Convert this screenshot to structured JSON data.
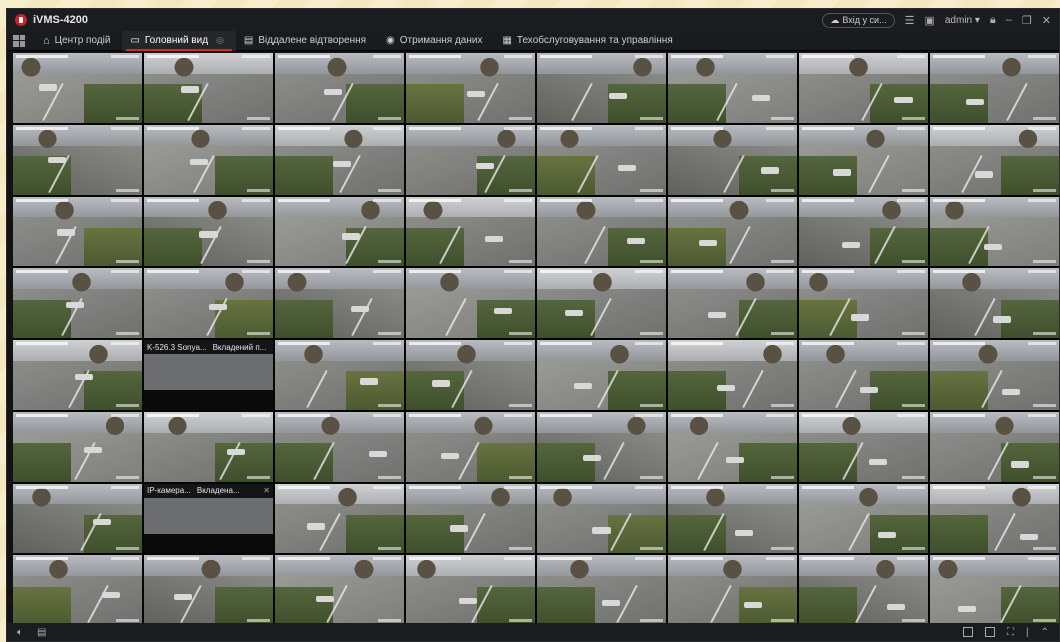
{
  "app": {
    "title": "iVMS-4200"
  },
  "titlebar": {
    "login_label": "Вхід у си...",
    "user_label": "admin",
    "user_caret": "▾"
  },
  "tabs": [
    {
      "label": "Центр подій",
      "icon": "home-icon",
      "active": false
    },
    {
      "label": "Головний вид",
      "icon": "main-view-icon",
      "active": true
    },
    {
      "label": "Віддалене відтворення",
      "icon": "playback-icon",
      "active": false
    },
    {
      "label": "Отримання даних",
      "icon": "data-icon",
      "active": false
    },
    {
      "label": "Техобслуговування та управління",
      "icon": "maintenance-icon",
      "active": false
    }
  ],
  "layout": {
    "rows": 8,
    "cols": 8
  },
  "cells": {
    "r4c1": {
      "camera": "K-526.3 Sonya...",
      "status": "Вкладений п..."
    },
    "r6c1": {
      "camera": "IP-камера...",
      "status": "Вкладена..."
    }
  },
  "colors": {
    "accent": "#d3262f",
    "window_bg": "#111214",
    "tab_bg": "#1a1b1e"
  }
}
